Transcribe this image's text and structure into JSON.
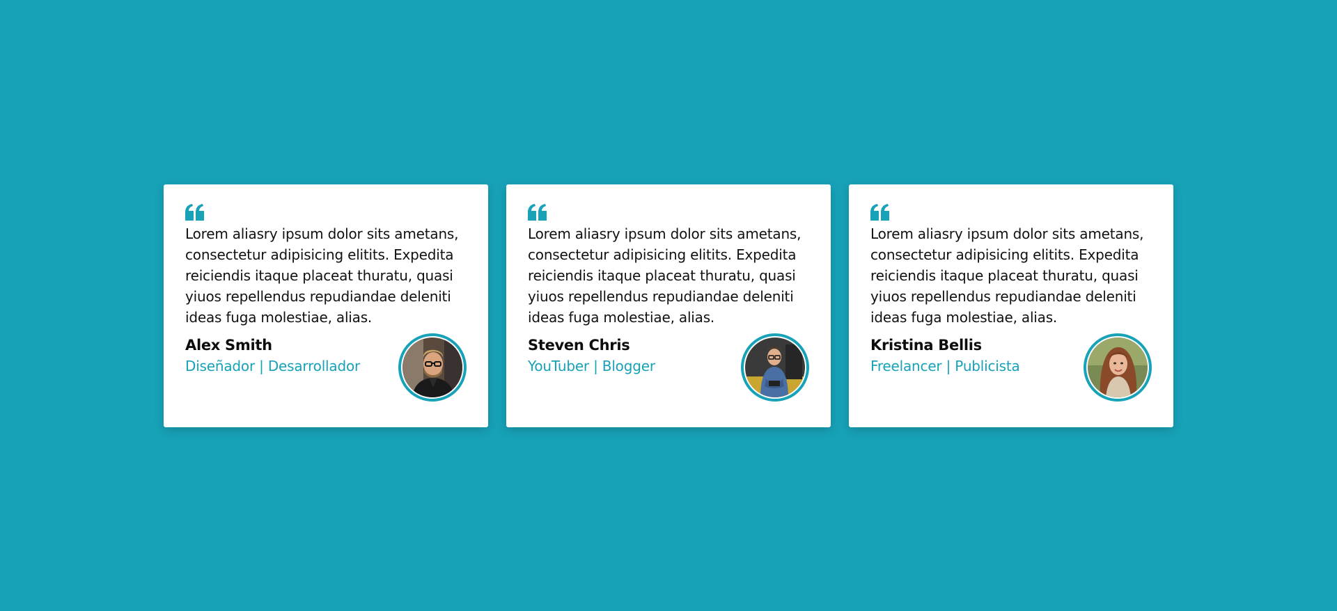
{
  "testimonials": [
    {
      "text": "Lorem aliasry ipsum dolor sits ametans, consectetur adipisicing elitits. Expedita reiciendis itaque placeat thuratu, quasi yiuos repellendus repudiandae deleniti ideas fuga molestiae, alias.",
      "name": "Alex Smith",
      "role": "Diseñador | Desarrollador",
      "avatar": "man-glasses-beard-avatar"
    },
    {
      "text": "Lorem aliasry ipsum dolor sits ametans, consectetur adipisicing elitits. Expedita reiciendis itaque placeat thuratu, quasi yiuos repellendus repudiandae deleniti ideas fuga molestiae, alias.",
      "name": "Steven Chris",
      "role": "YouTuber | Blogger",
      "avatar": "man-sitting-glasses-avatar"
    },
    {
      "text": "Lorem aliasry ipsum dolor sits ametans, consectetur adipisicing elitits. Expedita reiciendis itaque placeat thuratu, quasi yiuos repellendus repudiandae deleniti ideas fuga molestiae, alias.",
      "name": "Kristina Bellis",
      "role": "Freelancer | Publicista",
      "avatar": "woman-long-hair-avatar"
    }
  ],
  "colors": {
    "background": "#17a2b8",
    "accent": "#17a2b8",
    "card": "#ffffff",
    "text": "#111111"
  },
  "icons": {
    "quote": "quote-icon"
  }
}
